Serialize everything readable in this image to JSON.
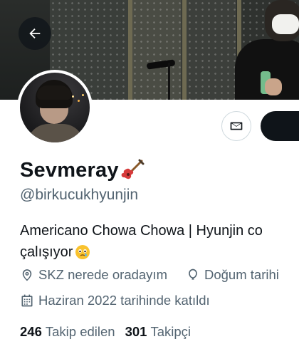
{
  "profile": {
    "display_name": "Sevmeray",
    "name_emoji": "guitar-emoji",
    "handle": "@birkucukhyunjin",
    "bio_line1": "Americano Chowa Chowa | Hyunjin co",
    "bio_line2": "çalışıyor",
    "bio_emoji": "face-holding-back-tears-emoji",
    "location": "SKZ nerede oradayım",
    "birthday": "Doğum tarihi",
    "joined": "Haziran 2022 tarihinde katıldı"
  },
  "stats": {
    "following_count": "246",
    "following_label": "Takip edilen",
    "followers_count": "301",
    "followers_label": "Takipçi"
  },
  "icons": {
    "back": "arrow-left-icon",
    "message": "envelope-icon",
    "location": "location-pin-icon",
    "birthday": "balloon-icon",
    "calendar": "calendar-icon"
  },
  "colors": {
    "text_primary": "#0f1419",
    "text_secondary": "#536471",
    "border": "#cfd9de",
    "follow_button": "#0f1419"
  }
}
